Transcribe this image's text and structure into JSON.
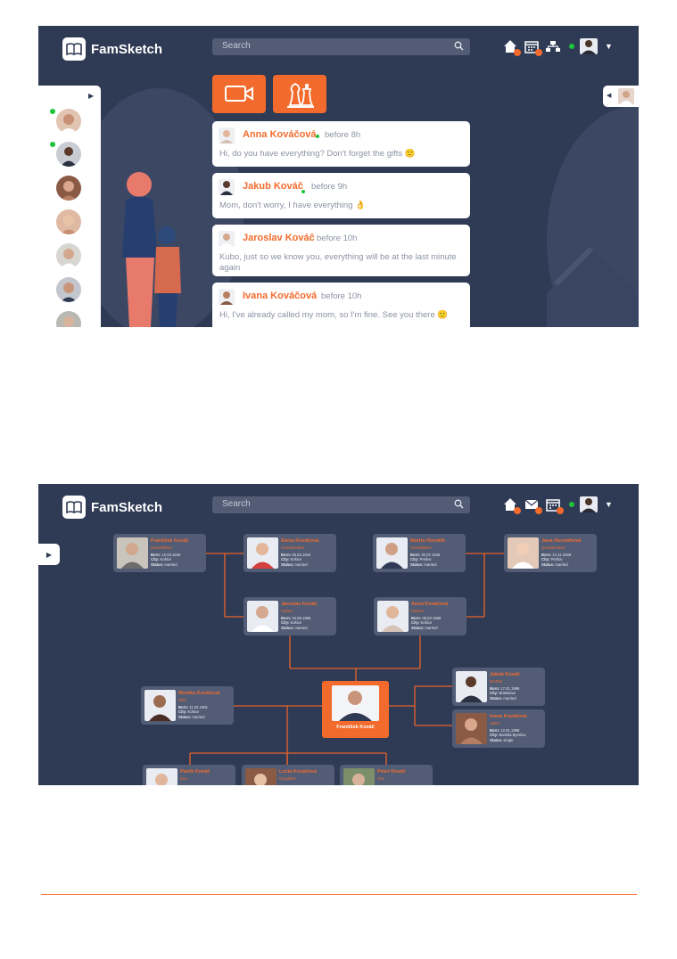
{
  "chat_screen": {
    "app_name": "FamSketch",
    "search": {
      "placeholder": "Search"
    },
    "messages": [
      {
        "name": "Anna Kováčová",
        "time": "before 8h",
        "online": true,
        "text": "Hi, do you have everything? Don't forget the gifts 🙂"
      },
      {
        "name": "Jakub Kováč",
        "time": "before 9h",
        "online": true,
        "text": "Mom, don't worry, I have everything 👌"
      },
      {
        "name": "Jaroslav Kováč",
        "time": "before 10h",
        "online": false,
        "text": "Kubo, just so we know you, everything will be at the last minute again"
      },
      {
        "name": "Ivana Kováčová",
        "time": "before 10h",
        "online": false,
        "text": "Hi, I've already called my mom, so I'm fine. See you there 🙂"
      }
    ],
    "nav_icons": [
      "home-icon",
      "calendar-icon",
      "family-tree-icon"
    ],
    "action_icons": [
      "video-call-icon",
      "chess-game-icon"
    ]
  },
  "tree_screen": {
    "app_name": "FamSketch",
    "search": {
      "placeholder": "Search"
    },
    "nav_icons": [
      "home-icon",
      "mail-icon",
      "calendar-icon"
    ],
    "members": {
      "frantisek_sr": {
        "name": "František Kováč",
        "rel": "Grandfather",
        "born": "12.03.1940",
        "city": "Košice",
        "status": "married"
      },
      "elena": {
        "name": "Elena Kováčová",
        "rel": "Grandmother",
        "born": "05.02.1944",
        "city": "Košice",
        "status": "married"
      },
      "martin": {
        "name": "Martin Horváth",
        "rel": "Grandfather",
        "born": "20.07.1946",
        "city": "Prešov",
        "status": "married"
      },
      "jana": {
        "name": "Jana Horváthová",
        "rel": "Grandmother",
        "born": "14.11.1948",
        "city": "Prešov",
        "status": "married"
      },
      "jaroslav": {
        "name": "Jaroslav Kováč",
        "rel": "Father",
        "born": "15.08.1965",
        "city": "Košice",
        "status": "married"
      },
      "anna": {
        "name": "Anna Kováčová",
        "rel": "Mother",
        "born": "08.03.1968",
        "city": "Košice",
        "status": "married"
      },
      "monika": {
        "name": "Monika Kováčová",
        "rel": "Wife",
        "born": "11.02.1991",
        "city": "Košice",
        "status": "married"
      },
      "jakub": {
        "name": "Jakub Kováč",
        "rel": "Brother",
        "born": "17.01.1996",
        "city": "Bratislava",
        "status": "married"
      },
      "ivana": {
        "name": "Ivana Kováčová",
        "rel": "Sister",
        "born": "12.01.1998",
        "city": "Banská Bystrica",
        "status": "single"
      },
      "patrik": {
        "name": "Patrik Kováč",
        "rel": "Son"
      },
      "lucia": {
        "name": "Lucia Kováčová",
        "rel": "Daughter"
      },
      "peter": {
        "name": "Peter Kováč",
        "rel": "Son"
      }
    },
    "center": {
      "name": "František Kováč"
    },
    "labels": {
      "born": "Born:",
      "city": "City:",
      "status": "Status:"
    }
  },
  "colors": {
    "panel": "#2f3a55",
    "accent": "#f26b2d",
    "online": "#1ec43a"
  }
}
